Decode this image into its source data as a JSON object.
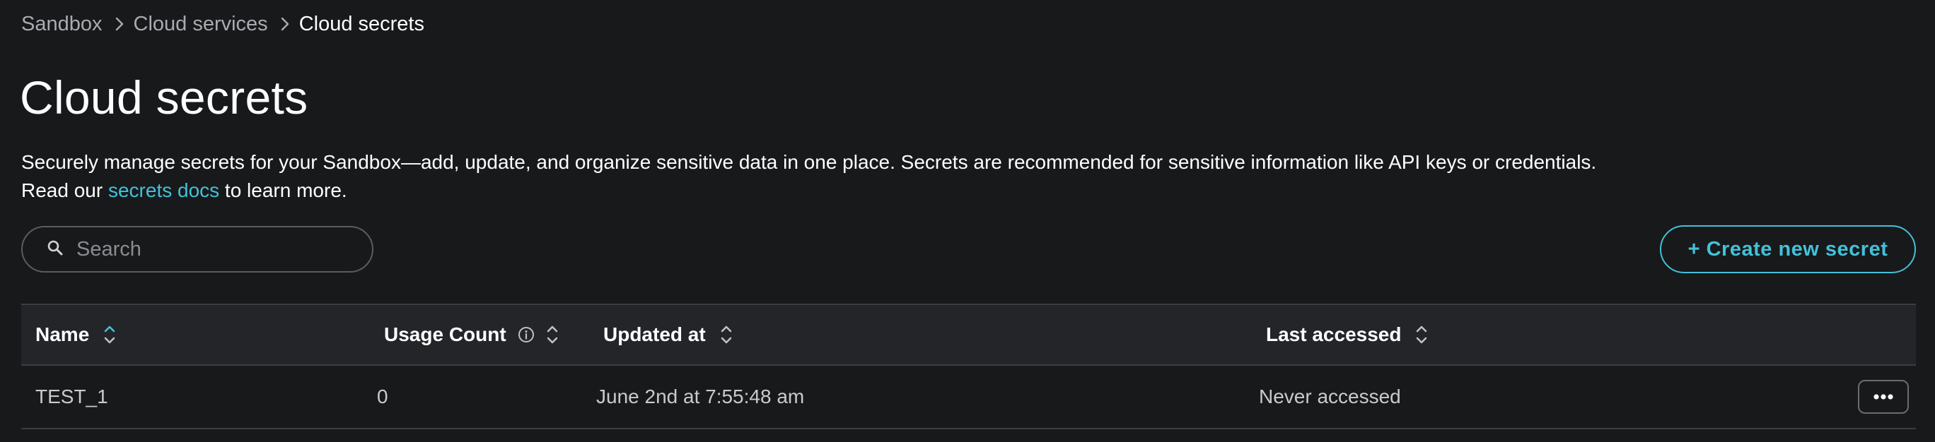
{
  "breadcrumb": {
    "items": [
      "Sandbox",
      "Cloud services",
      "Cloud secrets"
    ]
  },
  "page": {
    "title": "Cloud secrets",
    "description_line1": "Securely manage secrets for your Sandbox—add, update, and organize sensitive data in one place. Secrets are recommended for sensitive information like API keys or credentials.",
    "description_line2_prefix": "Read our ",
    "description_link": "secrets docs",
    "description_line2_suffix": " to learn more."
  },
  "search": {
    "placeholder": "Search",
    "value": ""
  },
  "create_button": {
    "label": "+ Create new secret"
  },
  "table": {
    "columns": [
      "Name",
      "Usage Count",
      "Updated at",
      "Last accessed"
    ],
    "rows": [
      {
        "name": "TEST_1",
        "usage_count": "0",
        "updated_at": "June 2nd at 7:55:48 am",
        "last_accessed": "Never accessed"
      }
    ]
  },
  "colors": {
    "background": "#18191b",
    "accent": "#43c1d9",
    "header_bg": "#232529"
  },
  "icons": {
    "breadcrumb_separator": "chevron-right-icon",
    "search": "search-icon",
    "sort": "sort-icon",
    "info": "info-icon",
    "more": "more-horizontal-icon"
  }
}
